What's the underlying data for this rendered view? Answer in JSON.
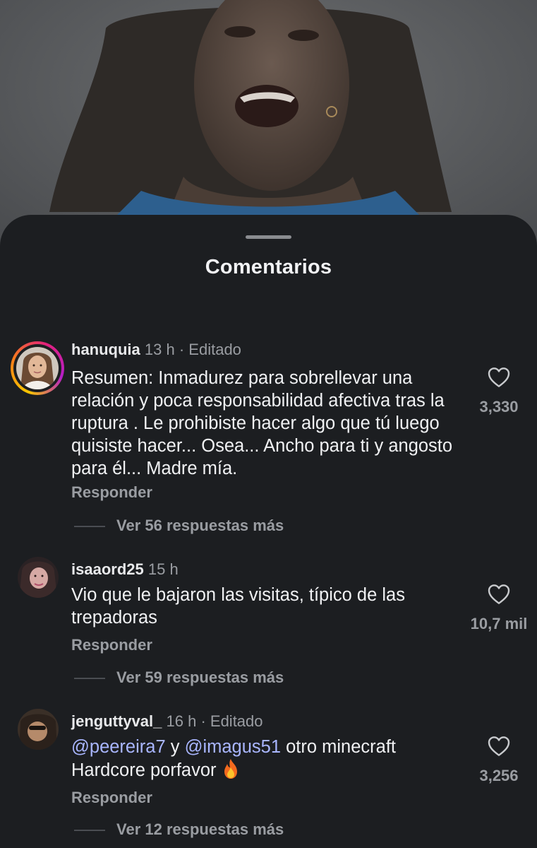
{
  "sheet": {
    "title": "Comentarios"
  },
  "comments": [
    {
      "username": "hanuquia",
      "time": "13 h",
      "edited": "· Editado",
      "text": "Resumen: Inmadurez para sobrellevar una relación y poca responsabilidad afectiva tras la ruptura . Le prohibiste hacer algo que tú luego quisiste hacer... Osea... Ancho para ti y angosto para él... Madre mía.",
      "likes": "3,330",
      "reply_label": "Responder",
      "view_replies": "Ver 56 respuestas más",
      "has_story_ring": true
    },
    {
      "username": "isaaord25",
      "time": "15 h",
      "text": "Vio que le bajaron las visitas, típico de las trepadoras",
      "likes": "10,7 mil",
      "reply_label": "Responder",
      "view_replies": "Ver 59 respuestas más",
      "has_story_ring": false
    },
    {
      "username": "jenguttyval_",
      "time": "16 h",
      "edited": "· Editado",
      "mention1": "@peereira7",
      "connector": "y",
      "mention2": "@imagus51",
      "text_after": "otro minecraft Hardcore porfavor",
      "emoji": "fire-emoji",
      "likes": "3,256",
      "reply_label": "Responder",
      "view_replies": "Ver 12 respuestas más",
      "has_story_ring": false
    }
  ],
  "colors": {
    "sheet_bg": "#1c1e21",
    "text_primary": "#f0f1f3",
    "text_secondary": "#9a9da2",
    "mention": "#a9b6ff"
  },
  "icons": {
    "like": "heart-outline-icon"
  }
}
